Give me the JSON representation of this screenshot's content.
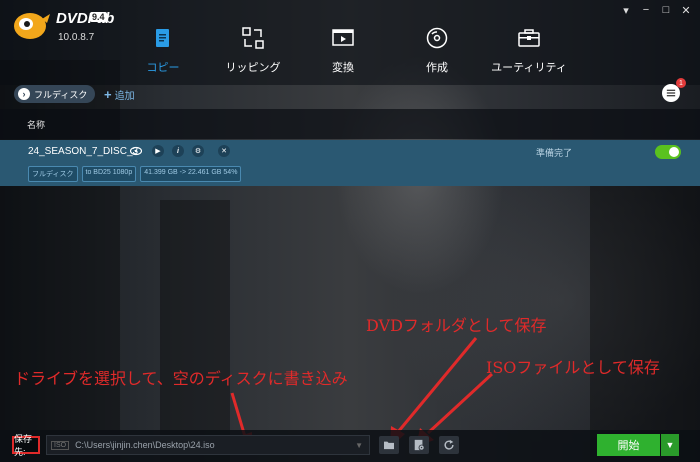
{
  "app": {
    "name": "DVDFab",
    "version_badge": "9.4",
    "version": "10.0.8.7"
  },
  "window_controls": [
    "▾",
    "−",
    "□",
    "✕"
  ],
  "nav": [
    {
      "label": "コピー",
      "icon": "copy-icon",
      "active": true
    },
    {
      "label": "リッピング",
      "icon": "ripper-icon",
      "active": false
    },
    {
      "label": "変換",
      "icon": "converter-icon",
      "active": false
    },
    {
      "label": "作成",
      "icon": "creator-icon",
      "active": false
    },
    {
      "label": "ユーティリティ",
      "icon": "utility-icon",
      "active": false
    }
  ],
  "toolbar": {
    "mode_label": "フルディスク",
    "add_label": "追加",
    "task_badge": "1"
  },
  "table": {
    "name_header": "名称"
  },
  "disc": {
    "title": "24_SEASON_7_DISC_3",
    "status": "準備完了",
    "enabled": true,
    "tags": [
      "フルディスク",
      "to BD25 1080p",
      "41.399 GB -> 22.461 GB 54%"
    ]
  },
  "annotations": {
    "dvd_folder": "DVDフォルダとして保存",
    "iso_file": "ISOファイルとして保存",
    "drive": "ドライブを選択して、空のディスクに書き込み"
  },
  "bottom": {
    "save_label": "保存先:",
    "iso_tag": "ISO",
    "path": "C:\\Users\\jinjin.chen\\Desktop\\24.iso",
    "start_label": "開始"
  },
  "colors": {
    "accent": "#2a9ce6",
    "row_selected": "#2a5872",
    "start_green": "#2fb12f",
    "annotation_red": "#e02a2a",
    "toggle_on": "#5ac21e"
  }
}
